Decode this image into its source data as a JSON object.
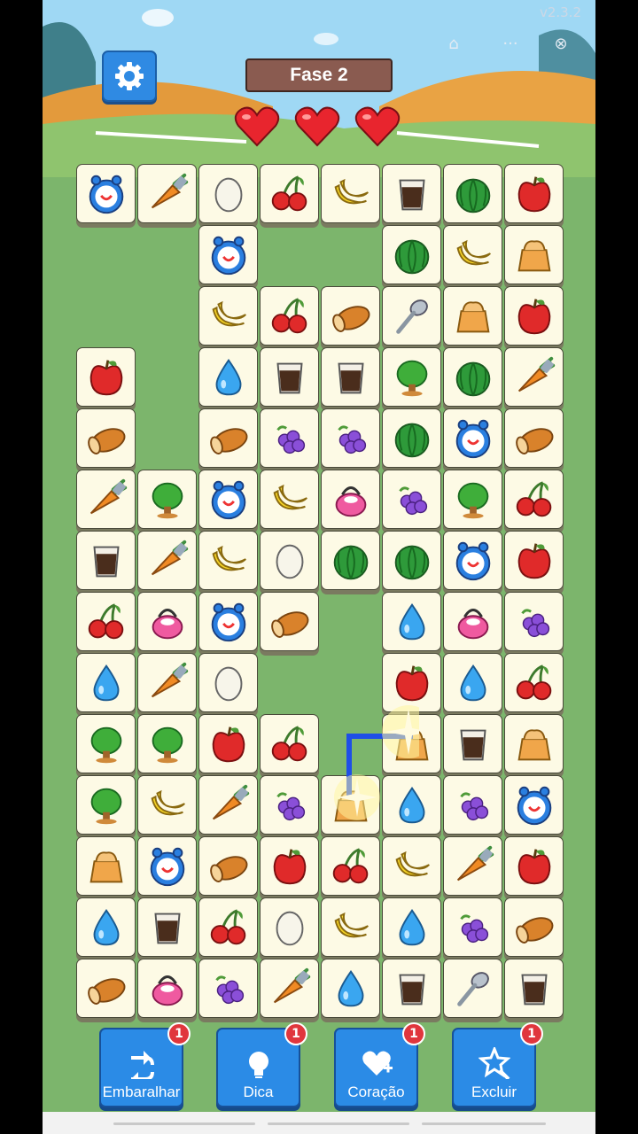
{
  "app": {
    "version": "v2.3.2"
  },
  "header": {
    "level_title": "Fase 2",
    "lives": 3,
    "settings_icon": "gear-icon",
    "home_icon": "home-icon",
    "menu_icon": "more-icon",
    "close_icon": "close-icon"
  },
  "colors": {
    "accent": "#2f8ae3",
    "board": "#7cb56c",
    "tile": "#fdfae5",
    "heart": "#e8252e",
    "badge": "#e0363d"
  },
  "board": {
    "columns": 8,
    "rows": [
      [
        "clock",
        "carrot",
        "egg",
        "cherry",
        "banana",
        "coffee",
        "melon",
        "apple"
      ],
      [
        null,
        null,
        "clock",
        null,
        null,
        "melon",
        "banana",
        "bag"
      ],
      [
        null,
        null,
        "banana",
        "cherry",
        "bread",
        "spoon",
        "bag",
        "apple"
      ],
      [
        "apple",
        null,
        "drop",
        "coffee",
        "coffee",
        "tree",
        "melon",
        "carrot"
      ],
      [
        "bread",
        null,
        "bread",
        "grapes",
        "grapes",
        "melon",
        "clock",
        "bread"
      ],
      [
        "carrot",
        "tree",
        "clock",
        "banana",
        "kettle",
        "grapes",
        "tree",
        "cherry"
      ],
      [
        "coffee",
        "carrot",
        "banana",
        "egg",
        "melon",
        "melon",
        "clock",
        "apple"
      ],
      [
        "cherry",
        "kettle",
        "clock",
        "bread",
        null,
        "drop",
        "kettle",
        "grapes"
      ],
      [
        "drop",
        "carrot",
        "egg",
        null,
        null,
        "apple",
        "drop",
        "cherry"
      ],
      [
        "tree",
        "tree",
        "apple",
        "cherry",
        null,
        "bag",
        "coffee",
        "bag"
      ],
      [
        "tree",
        "banana",
        "carrot",
        "grapes",
        "bag",
        "drop",
        "grapes",
        "clock"
      ],
      [
        "bag",
        "clock",
        "bread",
        "apple",
        "cherry",
        "banana",
        "carrot",
        "apple"
      ],
      [
        "drop",
        "coffee",
        "cherry",
        "egg",
        "banana",
        "drop",
        "grapes",
        "bread"
      ],
      [
        "bread",
        "kettle",
        "grapes",
        "carrot",
        "drop",
        "coffee",
        "spoon",
        "coffee"
      ]
    ]
  },
  "toolbar": {
    "buttons": [
      {
        "label": "Embaralhar",
        "icon": "shuffle-icon",
        "count": "1"
      },
      {
        "label": "Dica",
        "icon": "lightbulb-icon",
        "count": "1"
      },
      {
        "label": "Coração",
        "icon": "heart-plus-icon",
        "count": "1"
      },
      {
        "label": "Excluir",
        "icon": "magic-wand-icon",
        "count": "1"
      }
    ]
  }
}
